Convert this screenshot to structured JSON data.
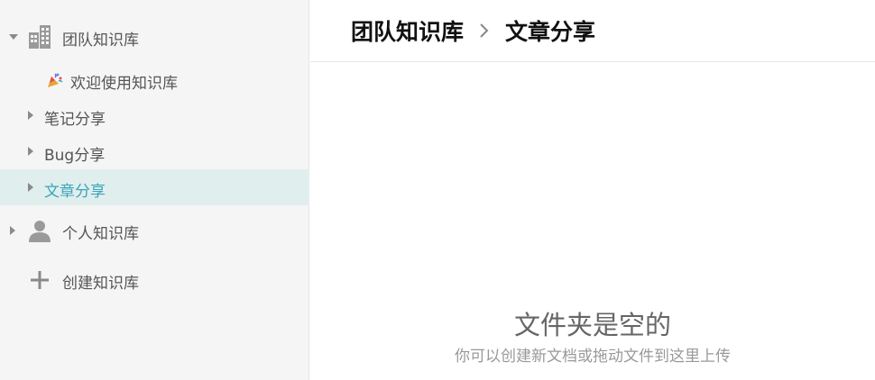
{
  "sidebar": {
    "team_kb": {
      "label": "团队知识库",
      "icon": "building-icon",
      "expanded": true
    },
    "children": [
      {
        "label": "欢迎使用知识库",
        "icon": "party-popper-icon"
      },
      {
        "label": "笔记分享",
        "icon": "caret-right-icon"
      },
      {
        "label": "Bug分享",
        "icon": "caret-right-icon"
      },
      {
        "label": "文章分享",
        "icon": "caret-right-icon",
        "selected": true
      }
    ],
    "personal_kb": {
      "label": "个人知识库",
      "icon": "user-icon",
      "expanded": false
    },
    "create_kb": {
      "label": "创建知识库",
      "icon": "plus-icon"
    }
  },
  "breadcrumb": {
    "parent": "团队知识库",
    "current": "文章分享"
  },
  "empty_state": {
    "title": "文件夹是空的",
    "subtitle": "你可以创建新文档或拖动文件到这里上传"
  },
  "colors": {
    "sidebar_bg": "#f5f5f5",
    "selected_bg": "#e0eeee",
    "selected_text": "#3aa6b9"
  }
}
